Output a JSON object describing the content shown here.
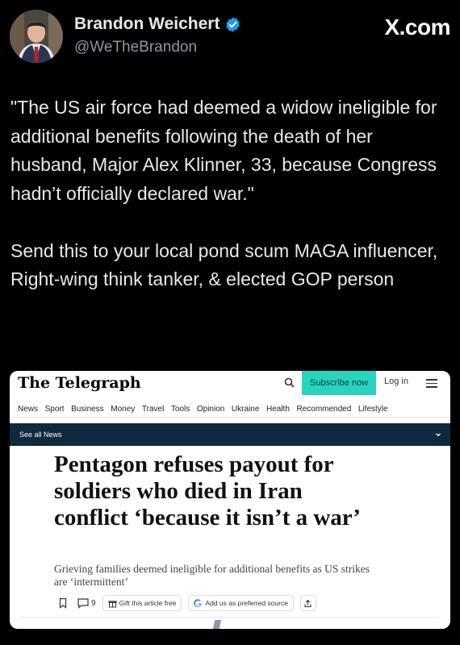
{
  "author": {
    "name": "Brandon Weichert",
    "handle": "@WeTheBrandon",
    "verified": true,
    "avatar_icon": "avatar-photo"
  },
  "brand": {
    "label": "X.com"
  },
  "tweet": {
    "paragraphs": [
      "\"The US air force had deemed a widow ineligible for additional benefits following the death of her husband, Major Alex Klinner, 33, because Congress hadn’t officially declared war.\"",
      "Send this to your local pond scum MAGA influencer, Right-wing think tanker, & elected GOP person"
    ]
  },
  "article": {
    "logo": "The Telegraph",
    "subscribe_label": "Subscribe now",
    "login_label": "Log in",
    "nav_items": [
      "News",
      "Sport",
      "Business",
      "Money",
      "Travel",
      "Tools",
      "Opinion",
      "Ukraine",
      "Health",
      "Recommended",
      "Lifestyle"
    ],
    "subnav_label": "See all News",
    "headline": "Pentagon refuses payout for soldiers who died in Iran conflict ‘because it isn’t a war’",
    "standfirst": "Grieving families deemed ineligible for additional benefits as US strikes are ‘intermittent’",
    "comment_count": "9",
    "gift_label": "Gift this article free",
    "source_label": "Add us as preferred source",
    "colors": {
      "subscribe": "#28d4bf",
      "subnav": "#0f2a3e"
    }
  }
}
